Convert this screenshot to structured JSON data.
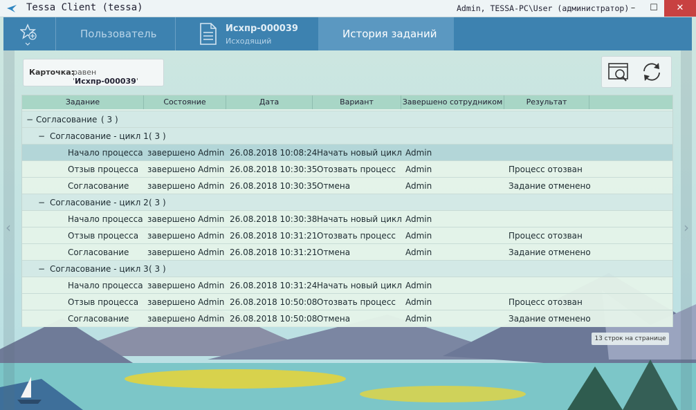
{
  "window": {
    "app_title": "Tessa Client (tessa)",
    "user_info": "Admin, TESSA-PC\\User (администратор)",
    "minimize": "–",
    "maximize": "☐",
    "close": "✕"
  },
  "tabs": {
    "user_label": "Пользователь",
    "card_number": "Исхпр-000039",
    "card_type": "Исходящий",
    "history_label": "История заданий"
  },
  "filter": {
    "label": "Карточка:",
    "prefix": "равен '",
    "value": "Исхпр-000039",
    "suffix": "'"
  },
  "grid": {
    "columns": [
      "Задание",
      "Состояние",
      "Дата",
      "Вариант",
      "Завершено сотрудником",
      "Результат"
    ],
    "groups": [
      {
        "label": "Согласование",
        "count": "( 3 )"
      },
      {
        "label": "Согласование - цикл 1",
        "count": "( 3 )"
      },
      {
        "label": "Согласование - цикл 2",
        "count": "( 3 )"
      },
      {
        "label": "Согласование - цикл 3",
        "count": "( 3 )"
      }
    ],
    "rows": [
      [
        "Начало процесса",
        "завершено Admin",
        "26.08.2018 10:08:24",
        "Начать новый цикл",
        "Admin",
        ""
      ],
      [
        "Отзыв процесса",
        "завершено Admin",
        "26.08.2018 10:30:35",
        "Отозвать процесс",
        "Admin",
        "Процесс отозван"
      ],
      [
        "Согласование",
        "завершено Admin",
        "26.08.2018 10:30:35",
        "Отмена",
        "Admin",
        "Задание отменено"
      ],
      [
        "Начало процесса",
        "завершено Admin",
        "26.08.2018 10:30:38",
        "Начать новый цикл",
        "Admin",
        ""
      ],
      [
        "Отзыв процесса",
        "завершено Admin",
        "26.08.2018 10:31:21",
        "Отозвать процесс",
        "Admin",
        "Процесс отозван"
      ],
      [
        "Согласование",
        "завершено Admin",
        "26.08.2018 10:31:21",
        "Отмена",
        "Admin",
        "Задание отменено"
      ],
      [
        "Начало процесса",
        "завершено Admin",
        "26.08.2018 10:31:24",
        "Начать новый цикл",
        "Admin",
        ""
      ],
      [
        "Отзыв процесса",
        "завершено Admin",
        "26.08.2018 10:50:08",
        "Отозвать процесс",
        "Admin",
        "Процесс отозван"
      ],
      [
        "Согласование",
        "завершено Admin",
        "26.08.2018 10:50:08",
        "Отмена",
        "Admin",
        "Задание отменено"
      ]
    ],
    "collapse_glyph": "−"
  },
  "pager": {
    "text": "13 строк на странице"
  },
  "icons": {
    "favorites": "star-add-icon",
    "card": "document-icon",
    "search": "search-window-icon",
    "refresh": "refresh-icon",
    "nav_left": "chevron-left-icon",
    "nav_right": "chevron-right-icon"
  },
  "colors": {
    "tabbar": "#3d82b0",
    "active_tab": "#5b98c1",
    "selected_row": "#b3d6d8",
    "close_button": "#c84141"
  }
}
